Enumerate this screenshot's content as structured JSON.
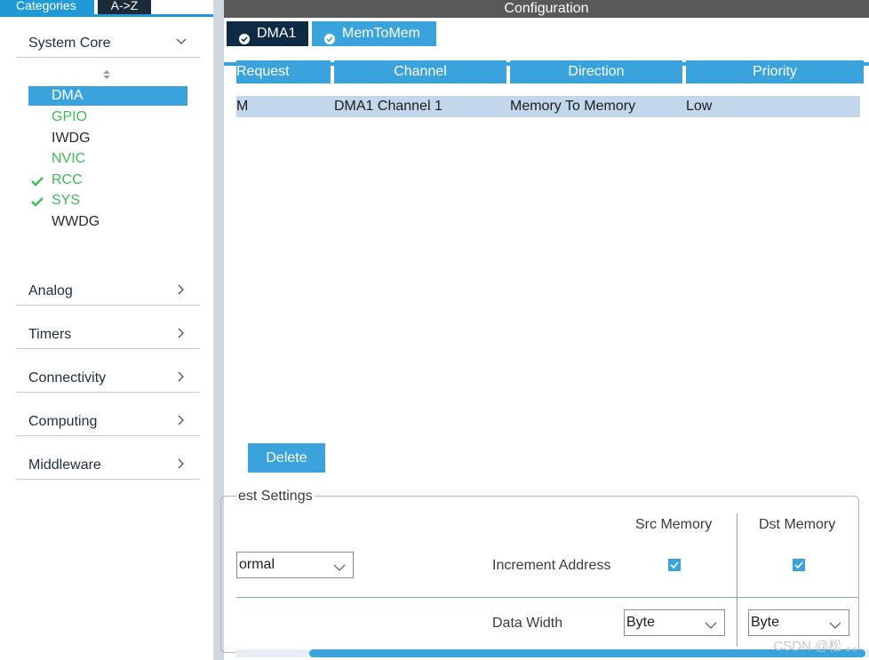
{
  "left_tabs": {
    "categories": "Categories",
    "az": "A->Z"
  },
  "categories": {
    "system_core": "System Core",
    "analog": "Analog",
    "timers": "Timers",
    "connectivity": "Connectivity",
    "computing": "Computing",
    "middleware": "Middleware"
  },
  "system_core_items": [
    "DMA",
    "GPIO",
    "IWDG",
    "NVIC",
    "RCC",
    "SYS",
    "WWDG"
  ],
  "config": {
    "title": "Configuration"
  },
  "mode_tabs": {
    "dma1": "DMA1",
    "memtomem": "MemToMem"
  },
  "table": {
    "headers": [
      "Request",
      "Channel",
      "Direction",
      "Priority"
    ],
    "row": [
      "M",
      "DMA1 Channel 1",
      "Memory To Memory",
      "Low"
    ]
  },
  "delete_label": "Delete",
  "settings": {
    "title": "est Settings",
    "src_memory": "Src Memory",
    "dst_memory": "Dst Memory",
    "mode_value": "ormal",
    "increment_address": "Increment Address",
    "data_width": "Data Width",
    "src_width_value": "Byte",
    "dst_width_value": "Byte",
    "src_increment_checked": true,
    "dst_increment_checked": true
  },
  "watermark": "CSDN @松 。。",
  "colors": {
    "accent": "#3aa3dc",
    "dark_tab": "#0e2a44",
    "status_green": "#3dbb55",
    "title_bar": "#595959"
  }
}
